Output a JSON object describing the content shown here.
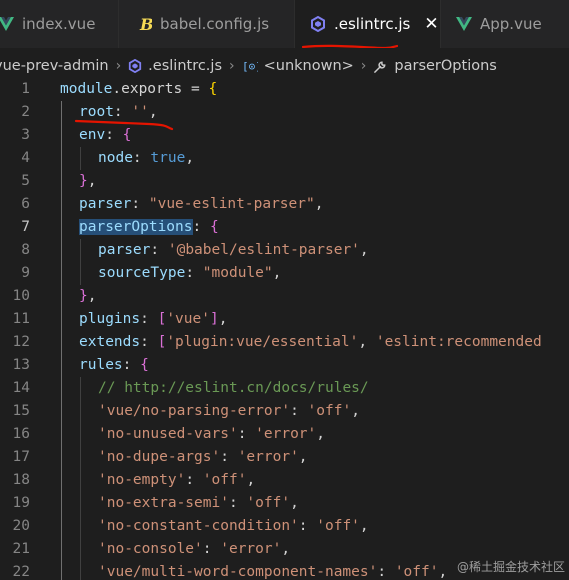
{
  "tabs": [
    {
      "label": "index.vue",
      "icon": "vue-icon"
    },
    {
      "label": "babel.config.js",
      "icon": "babel-icon"
    },
    {
      "label": ".eslintrc.js",
      "icon": "eslint-icon",
      "active": true
    },
    {
      "label": "App.vue",
      "icon": "vue-icon"
    }
  ],
  "breadcrumb": {
    "project": "vue-prev-admin",
    "file": ".eslintrc.js",
    "symbol": "<unknown>",
    "property": "parserOptions"
  },
  "editor": {
    "current_line": 7,
    "lines": [
      {
        "num": "1",
        "tokens": [
          [
            "module",
            "k"
          ],
          [
            ".exports",
            "p"
          ],
          [
            " = ",
            "p"
          ],
          [
            "{",
            "b1"
          ]
        ]
      },
      {
        "num": "2",
        "tokens": [
          [
            "root",
            "k"
          ],
          [
            ": ",
            "p"
          ],
          [
            "''",
            "s"
          ],
          [
            ",",
            "p"
          ]
        ]
      },
      {
        "num": "3",
        "tokens": [
          [
            "env",
            "k"
          ],
          [
            ": ",
            "p"
          ],
          [
            "{",
            "b2"
          ]
        ]
      },
      {
        "num": "4",
        "tokens": [
          [
            "node",
            "k"
          ],
          [
            ": ",
            "p"
          ],
          [
            "true",
            "kw"
          ],
          [
            ",",
            "p"
          ]
        ]
      },
      {
        "num": "5",
        "tokens": [
          [
            "}",
            "b2"
          ],
          [
            ",",
            "p"
          ]
        ]
      },
      {
        "num": "6",
        "tokens": [
          [
            "parser",
            "k"
          ],
          [
            ": ",
            "p"
          ],
          [
            "\"vue-eslint-parser\"",
            "s"
          ],
          [
            ",",
            "p"
          ]
        ]
      },
      {
        "num": "7",
        "tokens": [
          [
            "parserOptions",
            "k hl"
          ],
          [
            ": ",
            "p"
          ],
          [
            "{",
            "b2"
          ]
        ]
      },
      {
        "num": "8",
        "tokens": [
          [
            "parser",
            "k"
          ],
          [
            ": ",
            "p"
          ],
          [
            "'@babel/eslint-parser'",
            "s"
          ],
          [
            ",",
            "p"
          ]
        ]
      },
      {
        "num": "9",
        "tokens": [
          [
            "sourceType",
            "k"
          ],
          [
            ": ",
            "p"
          ],
          [
            "\"module\"",
            "s"
          ],
          [
            ",",
            "p"
          ]
        ]
      },
      {
        "num": "10",
        "tokens": [
          [
            "}",
            "b2"
          ],
          [
            ",",
            "p"
          ]
        ]
      },
      {
        "num": "11",
        "tokens": [
          [
            "plugins",
            "k"
          ],
          [
            ": ",
            "p"
          ],
          [
            "[",
            "b2"
          ],
          [
            "'vue'",
            "s"
          ],
          [
            "]",
            "b2"
          ],
          [
            ",",
            "p"
          ]
        ]
      },
      {
        "num": "12",
        "tokens": [
          [
            "extends",
            "k"
          ],
          [
            ": ",
            "p"
          ],
          [
            "[",
            "b2"
          ],
          [
            "'plugin:vue/essential'",
            "s"
          ],
          [
            ", ",
            "p"
          ],
          [
            "'eslint:recommended",
            "s"
          ]
        ]
      },
      {
        "num": "13",
        "tokens": [
          [
            "rules",
            "k"
          ],
          [
            ": ",
            "p"
          ],
          [
            "{",
            "b2"
          ]
        ]
      },
      {
        "num": "14",
        "tokens": [
          [
            "// ",
            "cmt"
          ],
          [
            "http://eslint.cn/docs/rules/",
            "cmt url"
          ]
        ]
      },
      {
        "num": "15",
        "tokens": [
          [
            "'vue/no-parsing-error'",
            "s"
          ],
          [
            ": ",
            "p"
          ],
          [
            "'off'",
            "s"
          ],
          [
            ",",
            "p"
          ]
        ]
      },
      {
        "num": "16",
        "tokens": [
          [
            "'no-unused-vars'",
            "s"
          ],
          [
            ": ",
            "p"
          ],
          [
            "'error'",
            "s"
          ],
          [
            ",",
            "p"
          ]
        ]
      },
      {
        "num": "17",
        "tokens": [
          [
            "'no-dupe-args'",
            "s"
          ],
          [
            ": ",
            "p"
          ],
          [
            "'error'",
            "s"
          ],
          [
            ",",
            "p"
          ]
        ]
      },
      {
        "num": "18",
        "tokens": [
          [
            "'no-empty'",
            "s"
          ],
          [
            ": ",
            "p"
          ],
          [
            "'off'",
            "s"
          ],
          [
            ",",
            "p"
          ]
        ]
      },
      {
        "num": "19",
        "tokens": [
          [
            "'no-extra-semi'",
            "s"
          ],
          [
            ": ",
            "p"
          ],
          [
            "'off'",
            "s"
          ],
          [
            ",",
            "p"
          ]
        ]
      },
      {
        "num": "20",
        "tokens": [
          [
            "'no-constant-condition'",
            "s"
          ],
          [
            ": ",
            "p"
          ],
          [
            "'off'",
            "s"
          ],
          [
            ",",
            "p"
          ]
        ]
      },
      {
        "num": "21",
        "tokens": [
          [
            "'no-console'",
            "s"
          ],
          [
            ": ",
            "p"
          ],
          [
            "'error'",
            "s"
          ],
          [
            ",",
            "p"
          ]
        ]
      },
      {
        "num": "22",
        "tokens": [
          [
            "'vue/multi-word-component-names'",
            "s"
          ],
          [
            ": ",
            "p"
          ],
          [
            "'off'",
            "s"
          ],
          [
            ",",
            "p"
          ]
        ]
      }
    ]
  },
  "watermark": "@稀土掘金技术社区",
  "colors": {
    "editor_bg": "#1e1e1e",
    "tabbar_bg": "#252526",
    "vue_green": "#41b883",
    "babel_yellow": "#f5da55",
    "eslint_purple": "#8080f2",
    "annotation_red": "#e51400"
  }
}
